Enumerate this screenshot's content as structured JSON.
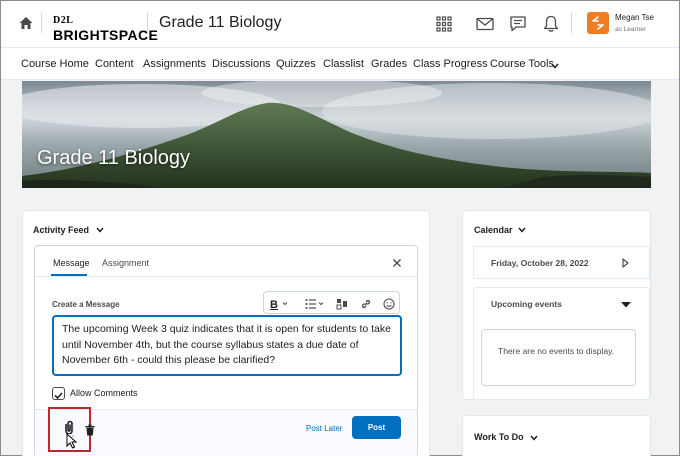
{
  "header": {
    "logo_top": "D2L",
    "logo_bottom": "BRIGHTSPACE",
    "course_title": "Grade 11 Biology",
    "user_name": "Megan Tse",
    "user_role": "as Learner",
    "icons": [
      "home-icon",
      "waffle-icon",
      "mail-icon",
      "chat-icon",
      "bell-icon"
    ]
  },
  "nav": {
    "items": [
      "Course Home",
      "Content",
      "Assignments",
      "Discussions",
      "Quizzes",
      "Classlist",
      "Grades",
      "Class Progress",
      "Course Tools"
    ]
  },
  "banner": {
    "title": "Grade 11 Biology"
  },
  "activity": {
    "title": "Activity Feed",
    "tabs": [
      "Message",
      "Assignment"
    ],
    "active_tab": "Message",
    "create_label": "Create a Message",
    "message_text": "The upcoming Week 3 quiz indicates that it is open for students to take until November 4th, but the course syllabus states a due date of November 6th - could this please be clarified?",
    "allow_comments_label": "Allow Comments",
    "allow_comments_checked": true,
    "post_later_label": "Post Later",
    "post_label": "Post"
  },
  "calendar": {
    "title": "Calendar",
    "date": "Friday, October 28, 2022",
    "upcoming_label": "Upcoming events",
    "empty_text": "There are no events to display."
  },
  "work_to_do": {
    "title": "Work To Do"
  },
  "colors": {
    "accent": "#006fbf",
    "avatar": "#f07c24",
    "highlight": "#c0262f"
  }
}
